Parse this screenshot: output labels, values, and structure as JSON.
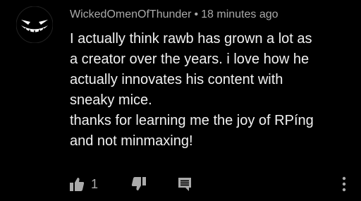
{
  "comment": {
    "author": "WickedOmenOfThunder",
    "separator": "•",
    "timestamp": "18 minutes ago",
    "paragraphs": [
      "I actually think rawb has grown a lot as\na creator over the years. i love how he\nactually innovates his content with\nsneaky mice.",
      "thanks for learning me the joy of RPíng\nand not minmaxing!"
    ],
    "like_count": "1"
  },
  "icons": {
    "avatar": "smiling-face-avatar",
    "like": "thumbs-up-icon",
    "dislike": "thumbs-down-icon",
    "reply": "reply-comment-icon",
    "more": "more-vertical-icon"
  },
  "colors": {
    "background": "#000000",
    "text": "#f1f1f1",
    "secondary": "#aaaaaa"
  }
}
